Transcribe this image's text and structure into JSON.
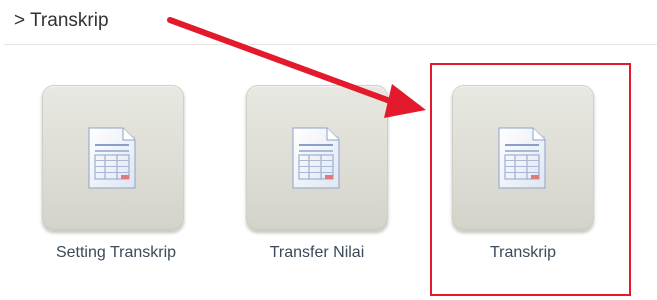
{
  "breadcrumb": {
    "text": "> Transkrip"
  },
  "menu": {
    "items": [
      {
        "label": "Setting Transkrip",
        "icon": "document-icon"
      },
      {
        "label": "Transfer Nilai",
        "icon": "document-icon"
      },
      {
        "label": "Transkrip",
        "icon": "document-icon",
        "highlighted": true
      }
    ]
  },
  "annotation": {
    "arrow_color": "#e21a2c",
    "highlight_color": "#e21a2c"
  }
}
